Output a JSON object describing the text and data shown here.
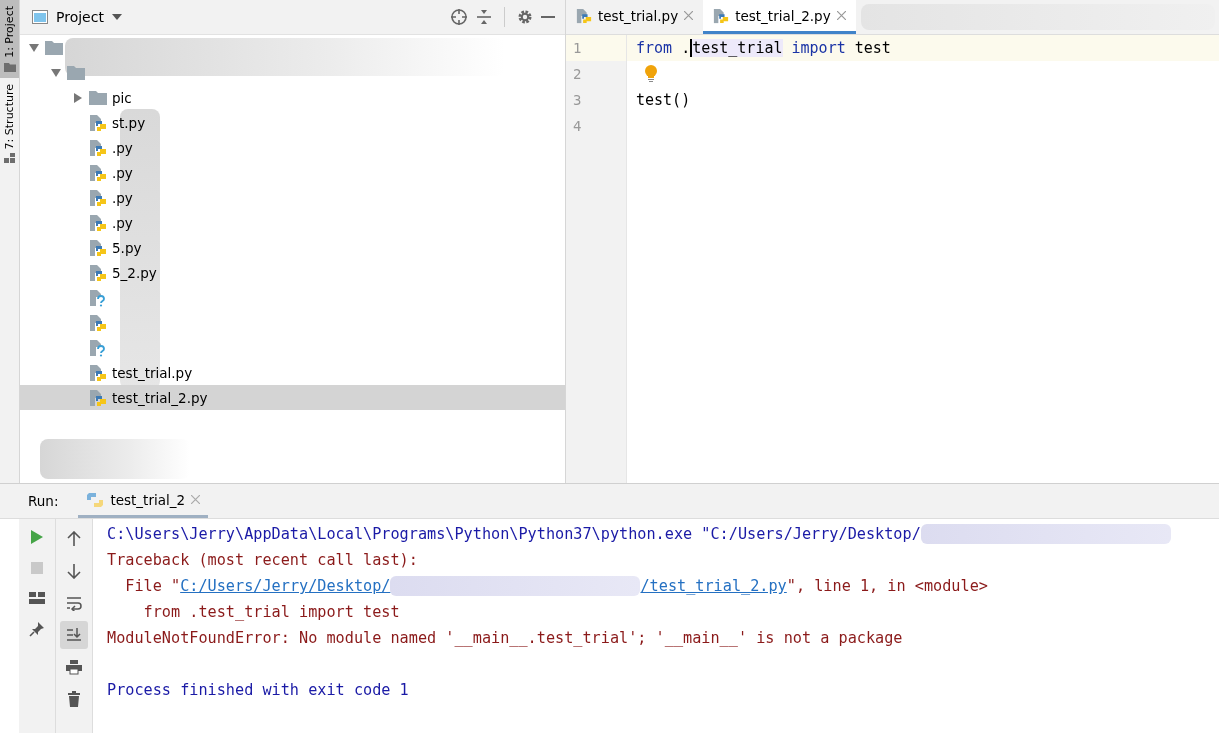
{
  "side_strip": {
    "tabs": [
      {
        "label": "1: Project",
        "selected": true
      },
      {
        "label": "7: Structure",
        "selected": false
      }
    ]
  },
  "project_panel": {
    "title": "Project",
    "tree": [
      {
        "kind": "folder",
        "expanded": true,
        "selected": false,
        "children": [
          {
            "kind": "folder",
            "expanded": true,
            "selected": false,
            "children": [
              {
                "kind": "folder",
                "name": "pic",
                "expanded": false,
                "selected": false
              },
              {
                "kind": "python",
                "name": "st.py",
                "selected": false
              },
              {
                "kind": "python",
                "name": ".py",
                "selected": false
              },
              {
                "kind": "python",
                "name": ".py",
                "selected": false
              },
              {
                "kind": "python",
                "name": ".py",
                "selected": false
              },
              {
                "kind": "python",
                "name": ".py",
                "selected": false
              },
              {
                "kind": "python",
                "name": "5.py",
                "selected": false
              },
              {
                "kind": "python",
                "name": "5_2.py",
                "selected": false
              },
              {
                "kind": "unknown",
                "selected": false
              },
              {
                "kind": "python",
                "selected": false
              },
              {
                "kind": "unknown",
                "selected": false
              },
              {
                "kind": "python",
                "name": "test_trial.py",
                "selected": false
              },
              {
                "kind": "python",
                "name": "test_trial_2.py",
                "selected": true
              }
            ]
          }
        ]
      }
    ]
  },
  "editor": {
    "tabs": [
      {
        "label": "test_trial.py",
        "selected": false
      },
      {
        "label": "test_trial_2.py",
        "selected": true
      }
    ],
    "lines": [
      {
        "number": "1",
        "current": true,
        "tokens": [
          {
            "kind": "keyword",
            "text": "from"
          },
          {
            "kind": "plain",
            "text": " ."
          },
          {
            "kind": "caret"
          },
          {
            "kind": "highlight",
            "text": "test_trial"
          },
          {
            "kind": "keyword",
            "text": "import"
          },
          {
            "kind": "plain",
            "text": " test"
          }
        ]
      },
      {
        "number": "2",
        "current": false,
        "tokens": [
          {
            "kind": "bulb"
          }
        ]
      },
      {
        "number": "3",
        "current": false,
        "tokens": [
          {
            "kind": "plain",
            "text": "test()"
          }
        ]
      },
      {
        "number": "4",
        "current": false
      }
    ]
  },
  "run_panel": {
    "label": "Run:",
    "tabs": [
      {
        "label": "test_trial_2",
        "selected": true
      }
    ],
    "toolbar": [
      {
        "kind": "run"
      },
      {
        "kind": "stop"
      },
      {
        "kind": "layout"
      },
      {
        "kind": "pin"
      }
    ],
    "toolbar_2": [
      {
        "kind": "up",
        "selected": false
      },
      {
        "kind": "down",
        "selected": false
      },
      {
        "kind": "wrap",
        "selected": false
      },
      {
        "kind": "scroll-end",
        "selected": true
      },
      {
        "kind": "print",
        "selected": false
      },
      {
        "kind": "trash",
        "selected": false
      }
    ],
    "console": [
      {
        "kind": "command",
        "segments": [
          {
            "kind": "text",
            "text": "C:\\Users\\Jerry\\AppData\\Local\\Programs\\Python\\Python37\\python.exe \"C:/Users/Jerry/Desktop/"
          },
          {
            "kind": "redacted"
          }
        ]
      },
      {
        "kind": "error",
        "segments": [
          {
            "kind": "text",
            "text": "Traceback (most recent call last):"
          }
        ]
      },
      {
        "kind": "error",
        "segments": [
          {
            "kind": "text",
            "text": "  File \""
          },
          {
            "kind": "link",
            "text": "C:/Users/Jerry/Desktop/"
          },
          {
            "kind": "redacted"
          },
          {
            "kind": "link",
            "text": "/test_trial_2.py"
          },
          {
            "kind": "text",
            "text": "\", line 1, in <module>"
          }
        ]
      },
      {
        "kind": "error",
        "segments": [
          {
            "kind": "text",
            "text": "    from .test_trial import test"
          }
        ]
      },
      {
        "kind": "error",
        "segments": [
          {
            "kind": "text",
            "text": "ModuleNotFoundError: No module named '__main__.test_trial'; '__main__' is not a package"
          }
        ]
      },
      {
        "kind": "blank"
      },
      {
        "kind": "command",
        "segments": [
          {
            "kind": "text",
            "text": "Process finished with exit code 1"
          }
        ]
      }
    ]
  }
}
